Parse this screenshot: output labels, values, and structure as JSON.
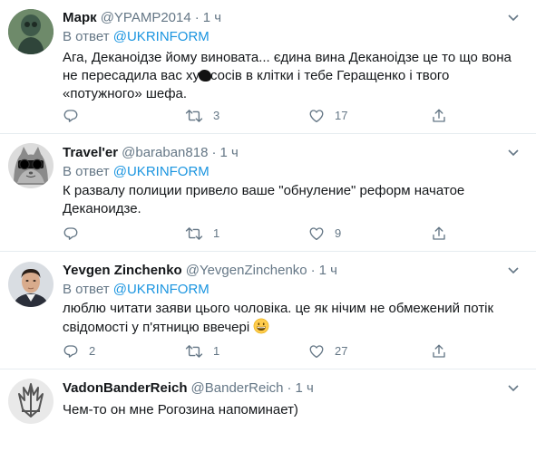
{
  "colors": {
    "text": "#14171a",
    "secondary": "#657786",
    "link": "#1b95e0",
    "border": "#e6ecf0"
  },
  "replying_prefix": "В ответ",
  "tweets": [
    {
      "name": "Марк",
      "handle": "@YPAMP2014",
      "dot": "·",
      "time": "1 ч",
      "reply_to": "@UKRINFORM",
      "text_parts": [
        "Ага, Деканоідзе йому виновата... єдина вина Деканоідзе це то що вона не пересадила вас ху",
        "сосів в клітки і тебе Геращенко і твого «потужного» шефа."
      ],
      "replies": "",
      "retweets": "3",
      "likes": "17"
    },
    {
      "name": "Travel'er",
      "handle": "@baraban818",
      "dot": "·",
      "time": "1 ч",
      "reply_to": "@UKRINFORM",
      "text": "К развалу полиции привело ваше \"обнуление\" реформ начатое Деканоидзе.",
      "replies": "",
      "retweets": "1",
      "likes": "9"
    },
    {
      "name": "Yevgen Zinchenko",
      "handle": "@YevgenZinchenko",
      "dot": "·",
      "time": "1 ч",
      "reply_to": "@UKRINFORM",
      "text": "люблю читати заяви цього чоловіка. це як нічим не обмежений потік свідомості у п'ятницю ввечері",
      "replies": "2",
      "retweets": "1",
      "likes": "27"
    },
    {
      "name": "VadonBanderReich",
      "handle": "@BanderReich",
      "dot": "·",
      "time": "1 ч",
      "text": "Чем-то он мне Рогозина напоминает)"
    }
  ],
  "icons": {
    "more": "chevron-down-icon",
    "reply": "reply-icon",
    "retweet": "retweet-icon",
    "like": "heart-icon",
    "share": "share-icon",
    "emoji": "grinning-face-emoji"
  }
}
